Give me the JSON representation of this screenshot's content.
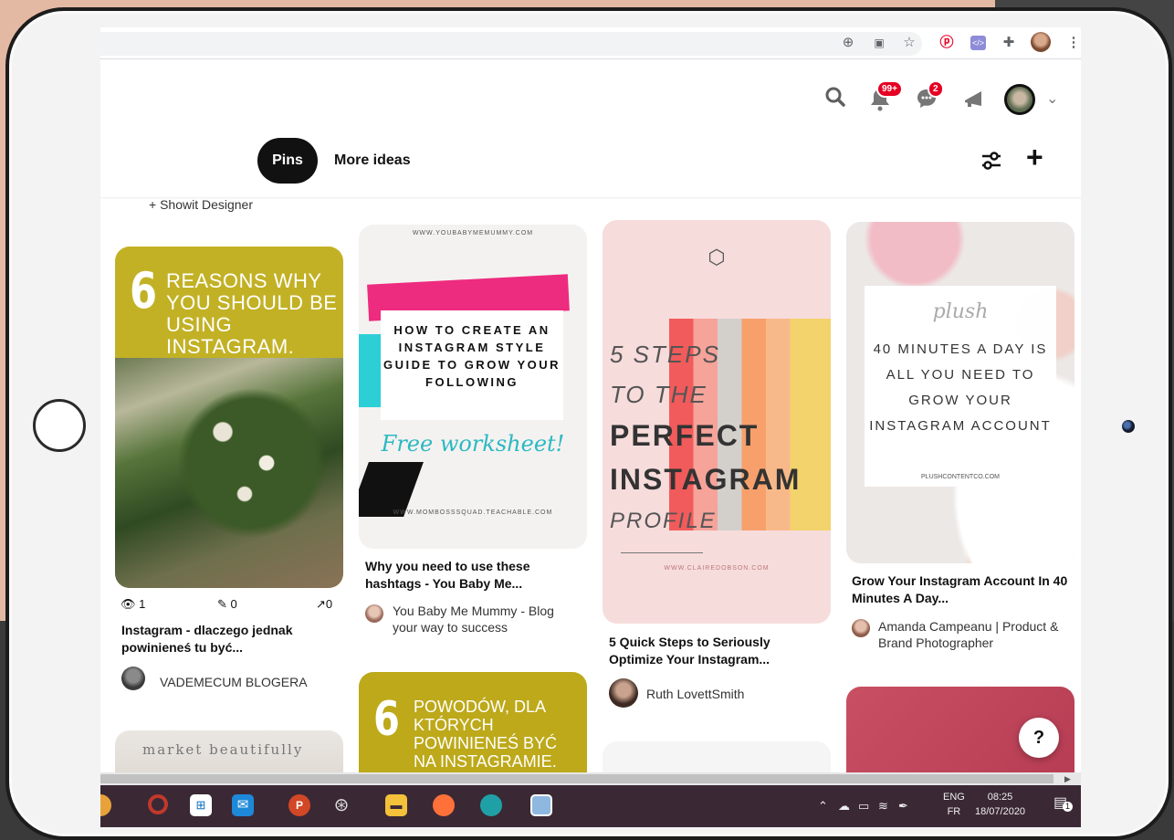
{
  "browser": {
    "icons": [
      "add-circle-icon",
      "translate-icon",
      "star-icon",
      "pinterest-icon",
      "code-extension-icon",
      "puzzle-icon",
      "profile-avatar",
      "kebab-menu-icon"
    ]
  },
  "header": {
    "notifications_badge": "99+",
    "messages_badge": "2",
    "tabs": [
      {
        "label": "Pins",
        "active": true
      },
      {
        "label": "More ideas",
        "active": false
      }
    ]
  },
  "board": {
    "collaborators_text": "+ Showit Designer"
  },
  "pins": [
    {
      "image_text_number": "6",
      "image_text": "REASONS WHY YOU SHOULD BE USING INSTAGRAM.",
      "stats": {
        "views": "1",
        "saves": "0",
        "clicks": "0"
      },
      "title": "Instagram - dlaczego jednak powinieneś tu być...",
      "owner": "VADEMECUM BLOGERA"
    },
    {
      "image_url_top": "WWW.YOUBABYMEMUMMY.COM",
      "image_text": "HOW TO CREATE AN INSTAGRAM STYLE GUIDE TO GROW YOUR FOLLOWING",
      "image_script": "Free worksheet!",
      "image_url_bottom": "WWW.MOMBOSSSQUAD.TEACHABLE.COM",
      "title": "Why you need to use these hashtags - You Baby Me...",
      "owner": "You Baby Me Mummy - Blog your way to success"
    },
    {
      "image_lines": [
        "5 STEPS",
        "TO THE",
        "PERFECT",
        "INSTAGRAM",
        "PROFILE"
      ],
      "image_url": "WWW.CLAIREDOBSON.COM",
      "title": "5 Quick Steps to Seriously Optimize Your Instagram...",
      "owner": "Ruth LovettSmith"
    },
    {
      "image_logo": "plush",
      "image_text": "40 MINUTES A DAY IS ALL YOU NEED TO GROW YOUR INSTAGRAM ACCOUNT",
      "image_url": "PLUSHCONTENTCO.COM",
      "title": "Grow Your Instagram Account In 40 Minutes A Day...",
      "owner": "Amanda Campeanu | Product & Brand Photographer"
    },
    {
      "image_text": "market  beautifully"
    },
    {
      "image_text_number": "6",
      "image_text": "POWODÓW, DLA KTÓRYCH POWINIENEŚ BYĆ NA INSTAGRAMIE."
    }
  ],
  "help_label": "?",
  "taskbar": {
    "lang_top": "ENG",
    "lang_bottom": "FR",
    "time": "08:25",
    "date": "18/07/2020",
    "notif_count": "1"
  }
}
